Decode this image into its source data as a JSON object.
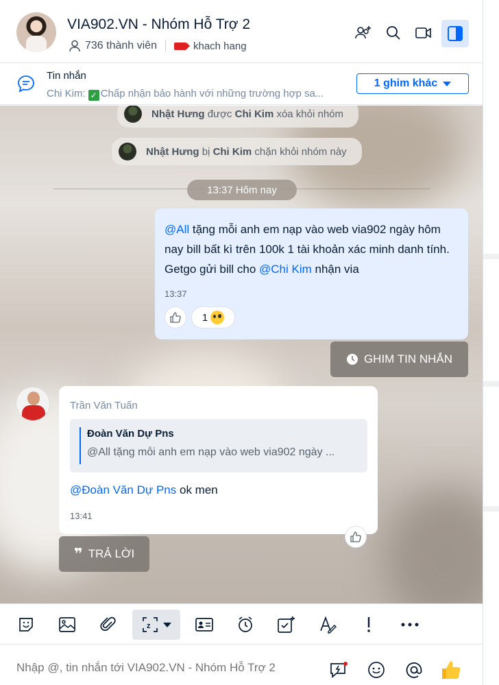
{
  "header": {
    "title": "VIA902.VN - Nhóm Hỗ Trợ 2",
    "members": "736 thành viên",
    "tag": "khach hang"
  },
  "pinned": {
    "title": "Tin nhắn",
    "sender": "Chi Kim:",
    "text": "Chấp nhận bảo hành với những trường hợp sa...",
    "more_label": "1 ghim khác"
  },
  "system_messages": [
    {
      "user": "Nhật Hưng",
      "verb": "được",
      "actor": "Chi Kim",
      "rest": "xóa khỏi nhóm"
    },
    {
      "user": "Nhật Hưng",
      "verb": "bị",
      "actor": "Chi Kim",
      "rest": "chặn khỏi nhóm này"
    }
  ],
  "time_separator": "13:37 Hôm nay",
  "my_message": {
    "mention_all": "@All",
    "text1": " tặng mỗi anh em nạp vào web via902 ngày hôm nay bill bất kì trên 100k 1 tài khoản xác minh danh tính. Getgo gửi bill cho ",
    "mention_user": "@Chi Kim",
    "text2": "  nhận via",
    "time": "13:37",
    "reaction_count": "1"
  },
  "pin_action_label": "GHIM TIN NHẮN",
  "other_message": {
    "sender": "Trần Văn Tuấn",
    "quote_name": "Đoàn Văn Dự Pns",
    "quote_text": "@All tặng mỗi anh em nạp vào web via902 ngày ...",
    "mention": "@Đoàn Văn Dự Pns",
    "text": " ok men",
    "time": "13:41"
  },
  "reply_label": "TRẢ LỜI",
  "input": {
    "placeholder": "Nhập @, tin nhắn tới VIA902.VN - Nhóm Hỗ Trợ 2"
  },
  "colors": {
    "accent": "#0068ff",
    "my_bubble": "#e5efff",
    "tag_red": "#e02020"
  }
}
